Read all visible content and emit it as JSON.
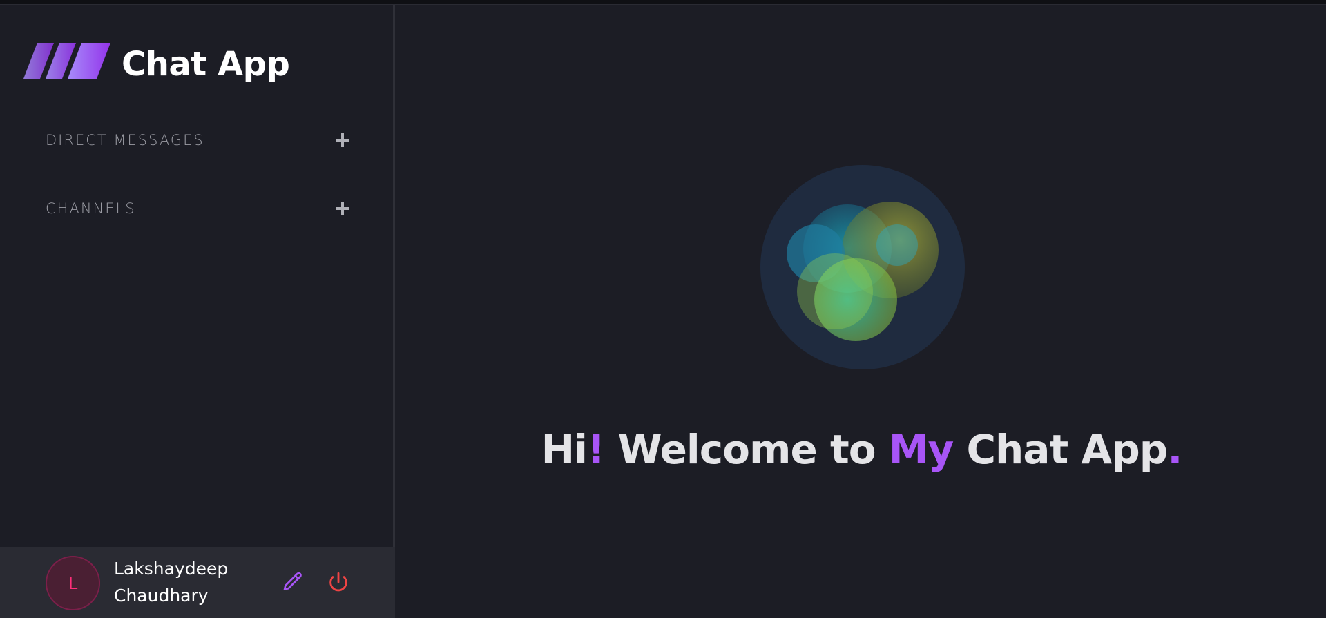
{
  "app": {
    "title": "Chat App"
  },
  "sidebar": {
    "sections": [
      {
        "label": "DIRECT MESSAGES"
      },
      {
        "label": "CHANNELS"
      }
    ]
  },
  "profile": {
    "initial": "L",
    "first_name": "Lakshaydeep",
    "last_name": "Chaudhary"
  },
  "welcome": {
    "hi": "Hi",
    "bang": "!",
    "welcome_to": " Welcome to ",
    "my": "My",
    "chat_app": " Chat App",
    "dot": "."
  },
  "colors": {
    "accent": "#a855f7",
    "background": "#1c1d25",
    "profile_bar": "#2a2b33",
    "logout": "#ef4444",
    "avatar_text": "#ff2e7a"
  },
  "icons": {
    "logo": "logo-stripes-icon",
    "add": "plus-icon",
    "edit": "pencil-icon",
    "logout": "power-icon"
  }
}
